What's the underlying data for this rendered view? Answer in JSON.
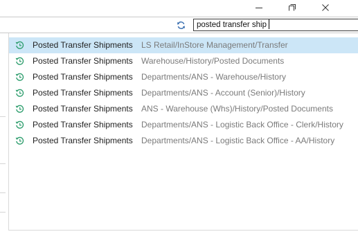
{
  "window": {
    "minimize_icon": "minimize-icon",
    "restore_icon": "restore-icon",
    "close_icon": "close-icon"
  },
  "search": {
    "value": "posted transfer ship",
    "refresh_icon": "refresh-icon"
  },
  "results": [
    {
      "name": "Posted Transfer Shipments",
      "path": "LS Retail/InStore Management/Transfer",
      "selected": true
    },
    {
      "name": "Posted Transfer Shipments",
      "path": "Warehouse/History/Posted Documents",
      "selected": false
    },
    {
      "name": "Posted Transfer Shipments",
      "path": "Departments/ANS - Warehouse/History",
      "selected": false
    },
    {
      "name": "Posted Transfer Shipments",
      "path": "Departments/ANS - Account (Senior)/History",
      "selected": false
    },
    {
      "name": "Posted Transfer Shipments",
      "path": "ANS - Warehouse (Whs)/History/Posted Documents",
      "selected": false
    },
    {
      "name": "Posted Transfer Shipments",
      "path": "Departments/ANS - Logistic Back Office - Clerk/History",
      "selected": false
    },
    {
      "name": "Posted Transfer Shipments",
      "path": "Departments/ANS - Logistic Back Office - AA/History",
      "selected": false
    }
  ],
  "colors": {
    "selection": "#cce6f7",
    "icon_green": "#2f9e6e",
    "path_text": "#7a7a7a"
  }
}
